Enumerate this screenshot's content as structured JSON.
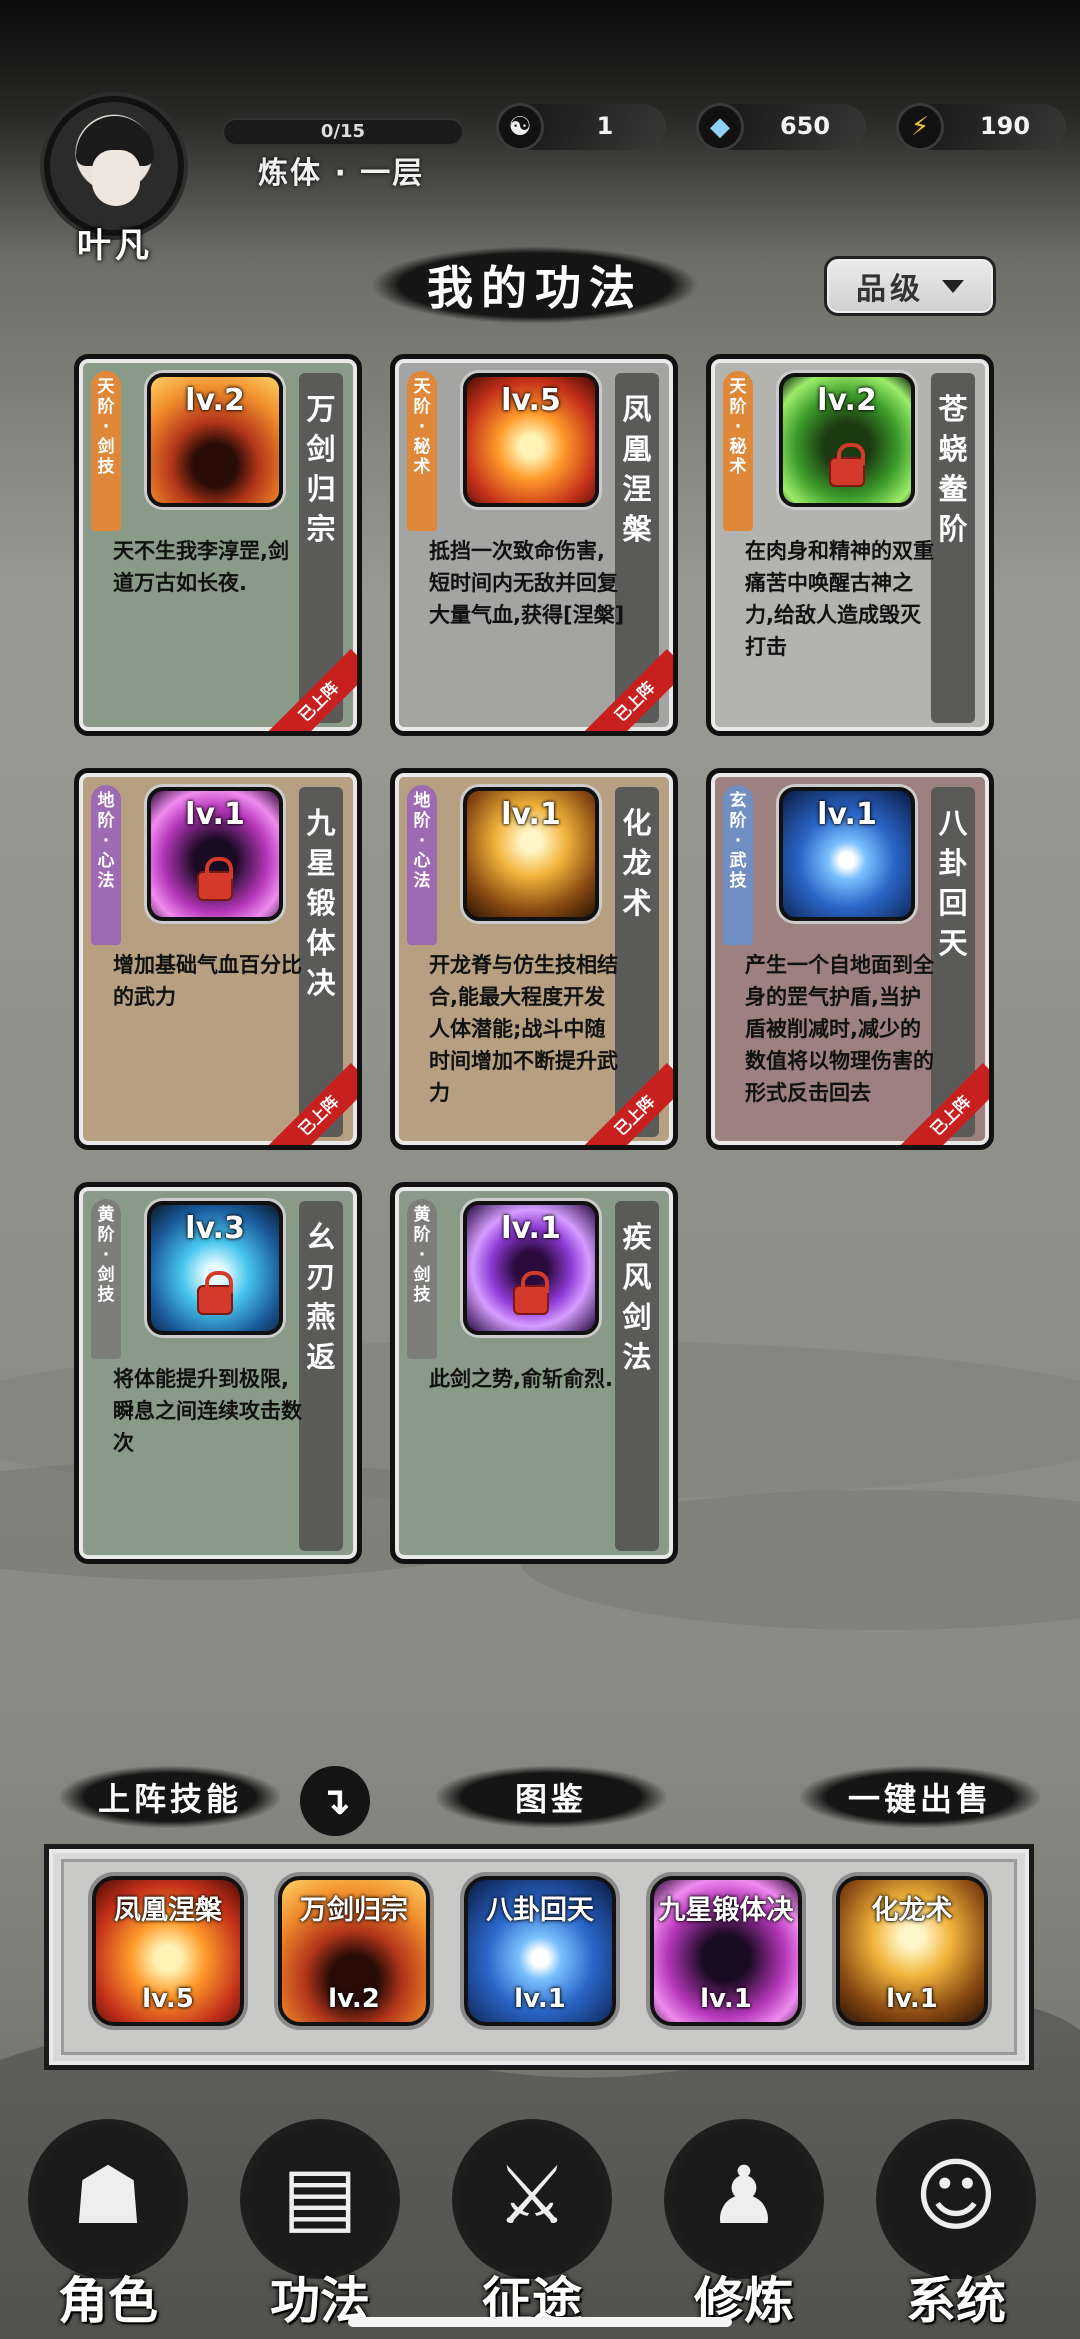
{
  "player": {
    "name": "叶凡",
    "exp_text": "0/15",
    "exp_fraction": 0.0,
    "realm": "炼体 · 一层"
  },
  "resources": [
    {
      "icon": "yin-yang-icon",
      "glyph": "☯",
      "value": "1"
    },
    {
      "icon": "crystal-icon",
      "glyph": "◆",
      "value": "650"
    },
    {
      "icon": "lightning-icon",
      "glyph": "⚡",
      "value": "190"
    }
  ],
  "page": {
    "title": "我的功法",
    "filter_label": "品级"
  },
  "cards": [
    {
      "tag": [
        "天",
        "阶",
        "·",
        "剑",
        "技"
      ],
      "level": "lv.2",
      "name": [
        "万",
        "剑",
        "归",
        "宗"
      ],
      "desc": "天不生我李淳罡,剑道万古如长夜.",
      "equipped": "已上阵",
      "locked": false
    },
    {
      "tag": [
        "天",
        "阶",
        "·",
        "秘",
        "术"
      ],
      "level": "lv.5",
      "name": [
        "凤",
        "凰",
        "涅",
        "槃"
      ],
      "desc": "抵挡一次致命伤害,短时间内无敌并回复大量气血,获得[涅槃]",
      "equipped": "已上阵",
      "locked": false
    },
    {
      "tag": [
        "天",
        "阶",
        "·",
        "秘",
        "术"
      ],
      "level": "lv.2",
      "name": [
        "苍",
        "蛲",
        "鲞",
        "阶"
      ],
      "desc": "在肉身和精神的双重痛苦中唤醒古神之力,给敌人造成毁灭打击",
      "equipped": "",
      "locked": true
    },
    {
      "tag": [
        "地",
        "阶",
        "·",
        "心",
        "法"
      ],
      "level": "lv.1",
      "name": [
        "九",
        "星",
        "锻",
        "体",
        "决"
      ],
      "desc": "增加基础气血百分比的武力",
      "equipped": "已上阵",
      "locked": true
    },
    {
      "tag": [
        "地",
        "阶",
        "·",
        "心",
        "法"
      ],
      "level": "lv.1",
      "name": [
        "化",
        "龙",
        "术"
      ],
      "desc": "开龙脊与仿生技相结合,能最大程度开发人体潜能;战斗中随时间增加不断提升武力",
      "equipped": "已上阵",
      "locked": false
    },
    {
      "tag": [
        "玄",
        "阶",
        "·",
        "武",
        "技"
      ],
      "level": "lv.1",
      "name": [
        "八",
        "卦",
        "回",
        "天"
      ],
      "desc": "产生一个自地面到全身的罡气护盾,当护盾被削减时,减少的数值将以物理伤害的形式反击回去",
      "equipped": "已上阵",
      "locked": false
    },
    {
      "tag": [
        "黄",
        "阶",
        "·",
        "剑",
        "技"
      ],
      "level": "lv.3",
      "name": [
        "幺",
        "刃",
        "燕",
        "返"
      ],
      "desc": "将体能提升到极限,瞬息之间连续攻击数次",
      "equipped": "",
      "locked": true
    },
    {
      "tag": [
        "黄",
        "阶",
        "·",
        "剑",
        "技"
      ],
      "level": "lv.1",
      "name": [
        "疾",
        "风",
        "剑",
        "法"
      ],
      "desc": "此剑之势,俞斩俞烈.",
      "equipped": "",
      "locked": true
    }
  ],
  "bottom": {
    "equipped_label": "上阵技能",
    "arrow": "↴",
    "codex_label": "图鉴",
    "sell_label": "一键出售"
  },
  "slots": [
    {
      "name": "凤凰涅槃",
      "level": "lv.5"
    },
    {
      "name": "万剑归宗",
      "level": "lv.2"
    },
    {
      "name": "八卦回天",
      "level": "lv.1"
    },
    {
      "name": "九星锻体决",
      "level": "lv.1"
    },
    {
      "name": "化龙术",
      "level": "lv.1"
    }
  ],
  "nav": [
    {
      "label": "角色",
      "icon": "hooded-figure-icon"
    },
    {
      "label": "功法",
      "icon": "scroll-book-icon"
    },
    {
      "label": "征途",
      "icon": "sword-emblem-icon"
    },
    {
      "label": "修炼",
      "icon": "meditating-figure-icon"
    },
    {
      "label": "系统",
      "icon": "bear-mascot-icon"
    }
  ]
}
